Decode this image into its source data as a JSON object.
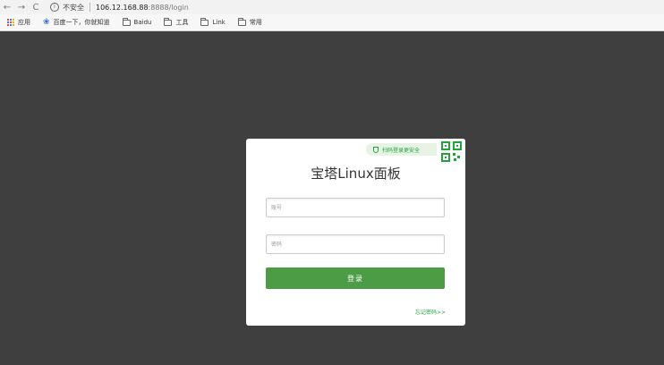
{
  "browser": {
    "back": "←",
    "forward": "→",
    "reload": "C",
    "insecure_label": "不安全",
    "url_host": "106.12.168.88",
    "url_rest": ":8888/login"
  },
  "bookmarks": {
    "apps": "应用",
    "items": [
      "百度一下，你就知道",
      "Baidu",
      "工具",
      "Link",
      "常用"
    ]
  },
  "login": {
    "qr_tip": "扫码登录更安全",
    "title": "宝塔Linux面板",
    "username_placeholder": "账号",
    "password_placeholder": "密码",
    "login_button": "登录",
    "forgot_link": "忘记密码>>"
  },
  "colors": {
    "background": "#3f3f3f",
    "brand_green": "#20a53a",
    "button_green": "#4c9c46"
  }
}
